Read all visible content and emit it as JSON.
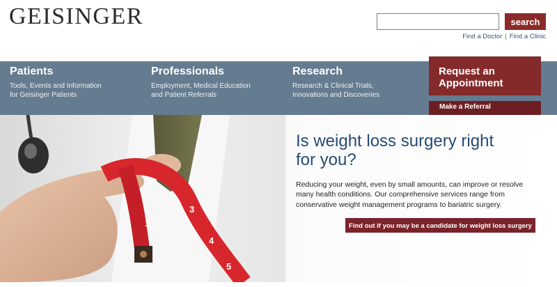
{
  "header": {
    "logo_text": "GEISINGER",
    "search": {
      "value": "",
      "placeholder": "",
      "button_label": "search"
    },
    "utility_links": [
      "Find a Doctor",
      "Find a Clinic"
    ],
    "utility_separator": "|"
  },
  "nav": {
    "items": [
      {
        "title": "Patients",
        "desc_line1": "Tools, Events and Information",
        "desc_line2": "for Geisinger Patients"
      },
      {
        "title": "Professionals",
        "desc_line1": "Employment, Medical Education",
        "desc_line2": "and Patient Referrals"
      },
      {
        "title": "Research",
        "desc_line1": "Research & Clinical Trials,",
        "desc_line2": "Innovations and Discoveries"
      }
    ],
    "request_line1": "Request an",
    "request_line2": "Appointment",
    "referral_label": "Make a Referral"
  },
  "hero": {
    "heading_line1": "Is weight loss surgery right",
    "heading_line2": "for you?",
    "body_line1": "Reducing your weight, even by small amounts, can improve or resolve",
    "body_line2": "many health conditions. Our comprehensive services range from",
    "body_line3": "conservative weight management programs to bariatric surgery.",
    "cta_label": "Find out if you may be a candidate for weight loss surgery",
    "tape_numbers": [
      "2",
      "3",
      "4",
      "1",
      "5"
    ]
  },
  "colors": {
    "brand_red": "#852a2b",
    "nav_blue": "#657b8f",
    "heading_blue": "#264b73",
    "tape_red": "#d8262d"
  }
}
